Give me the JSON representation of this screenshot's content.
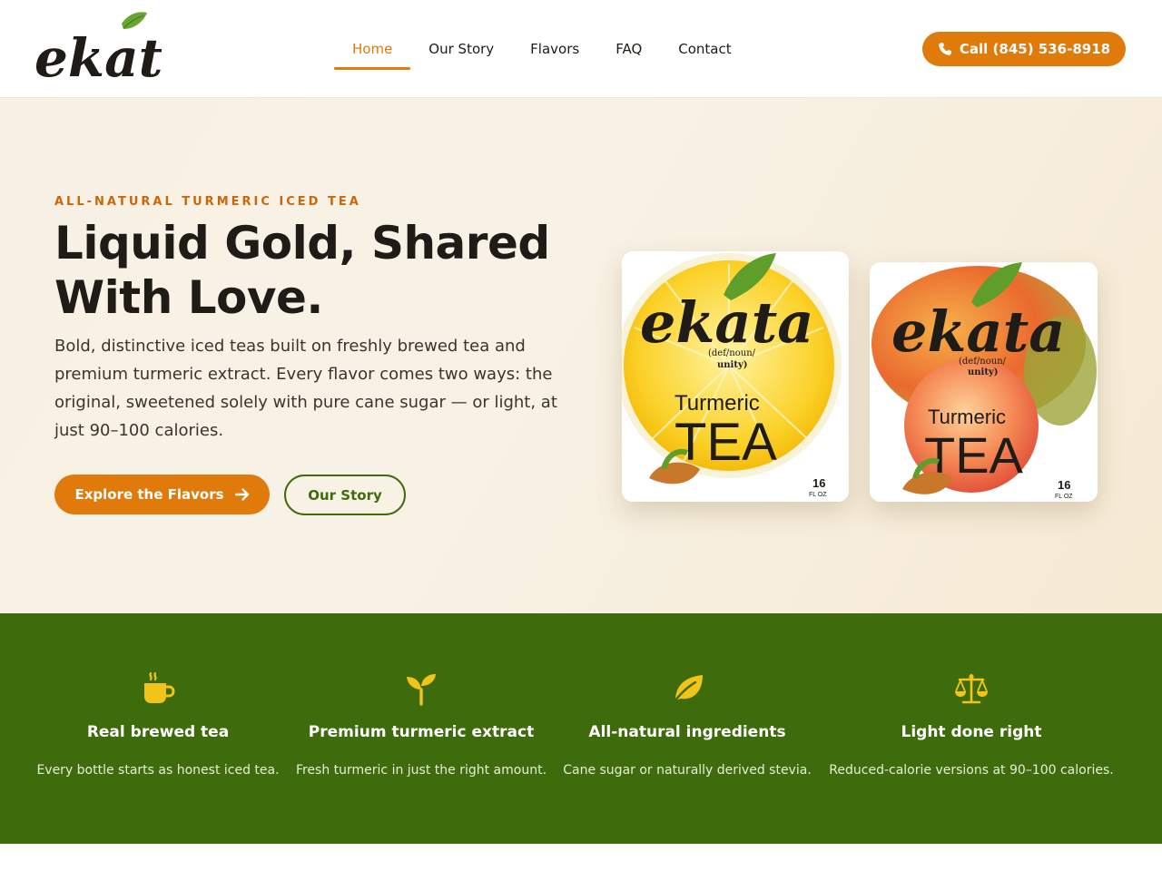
{
  "brand": {
    "logo_text": "ekata"
  },
  "nav": {
    "items": [
      {
        "label": "Home",
        "active": true
      },
      {
        "label": "Our Story",
        "active": false
      },
      {
        "label": "Flavors",
        "active": false
      },
      {
        "label": "FAQ",
        "active": false
      },
      {
        "label": "Contact",
        "active": false
      }
    ],
    "call_label": "Call (845) 536-8918"
  },
  "hero": {
    "eyebrow": "ALL-NATURAL TURMERIC ICED TEA",
    "title": "Liquid Gold, Shared With Love.",
    "description": "Bold, distinctive iced teas built on freshly brewed tea and premium turmeric extract. Every flavor comes two ways: the original, sweetened solely with pure cane sugar — or light, at just 90–100 calories.",
    "primary_button": "Explore the Flavors",
    "secondary_button": "Our Story",
    "products": [
      {
        "brand": "ekata",
        "definition": "(def/noun/",
        "definition_word": "unity)",
        "line1": "Turmeric",
        "line2": "TEA",
        "size": "16",
        "unit": "FL OZ",
        "flavor_color": "lemon"
      },
      {
        "brand": "ekata",
        "definition": "(def/noun/",
        "definition_word": "unity)",
        "line1": "Turmeric",
        "line2": "TEA",
        "size": "16",
        "unit": "FL OZ",
        "flavor_color": "peach-mango"
      }
    ]
  },
  "features": [
    {
      "icon": "mug-hot-icon",
      "title": "Real brewed tea",
      "description": "Every bottle starts as honest iced tea."
    },
    {
      "icon": "seedling-icon",
      "title": "Premium turmeric extract",
      "description": "Fresh turmeric in just the right amount."
    },
    {
      "icon": "leaf-icon",
      "title": "All-natural ingredients",
      "description": "Cane sugar or naturally derived stevia."
    },
    {
      "icon": "scale-balanced-icon",
      "title": "Light done right",
      "description": "Reduced-calorie versions at 90–100 calories."
    }
  ],
  "colors": {
    "accent": "#e07a0b",
    "green": "#3e6b0b",
    "icon_yellow": "#f2c318",
    "hero_bg": "#f7f0e3"
  }
}
